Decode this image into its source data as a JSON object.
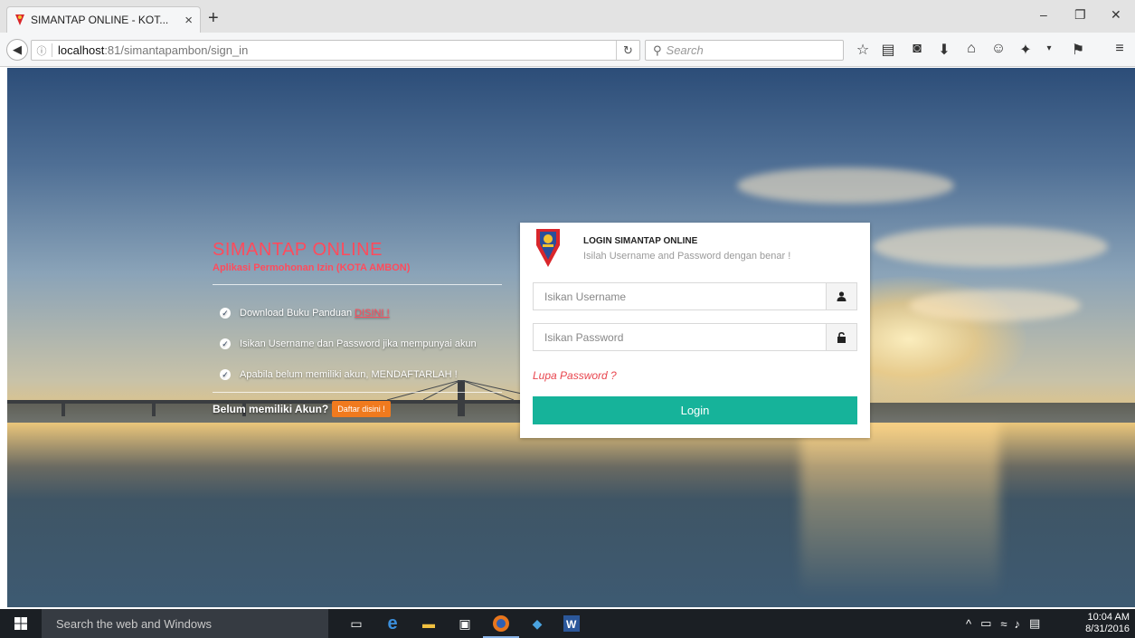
{
  "browser": {
    "tab_title": "SIMANTAP ONLINE - KOT...",
    "tab_close": "×",
    "new_tab": "+",
    "url_host": "localhost",
    "url_path": ":81/simantapambon/sign_in",
    "search_placeholder": "Search",
    "window_controls": {
      "minimize": "–",
      "maximize": "❐",
      "close": "✕"
    }
  },
  "info": {
    "app_title": "SIMANTAP ONLINE",
    "app_subtitle": "Aplikasi Permohonan Izin (KOTA AMBON)",
    "items": [
      {
        "text": "Download Buku Panduan",
        "link": "DISINI !"
      },
      {
        "text": "Isikan Username dan Password jika mempunyai akun"
      },
      {
        "text": "Apabila belum memiliki akun, MENDAFTARLAH !"
      }
    ],
    "no_account_text": "Belum memiliki Akun?",
    "register_button": "Daftar disini !"
  },
  "login": {
    "title": "LOGIN SIMANTAP ONLINE",
    "subtitle": "Isilah Username and Password dengan benar !",
    "username_placeholder": "Isikan Username",
    "password_placeholder": "Isikan Password",
    "forgot_password": "Lupa Password ?",
    "login_button": "Login"
  },
  "taskbar": {
    "search_placeholder": "Search the web and Windows",
    "time": "10:04 AM",
    "date": "8/31/2016"
  },
  "colors": {
    "accent_red": "#ff4b5c",
    "login_button": "#16b39a",
    "register_button": "#f07a1e"
  }
}
